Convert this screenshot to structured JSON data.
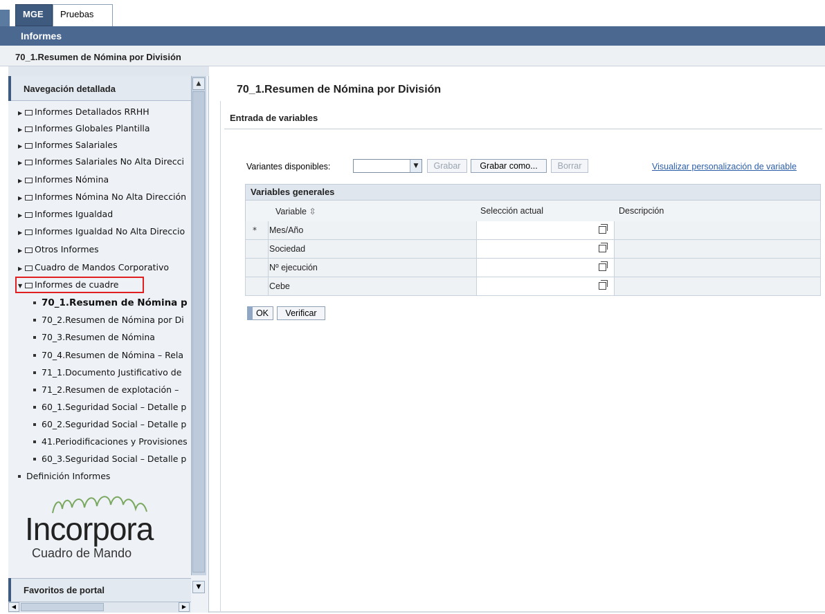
{
  "top_tabs": [
    {
      "label": "MGE"
    },
    {
      "label": "Pruebas"
    }
  ],
  "header": {
    "title": "Informes"
  },
  "breadcrumb": {
    "title": "70_1.Resumen de Nómina por División"
  },
  "nav": {
    "header": "Navegación detallada",
    "folders": [
      {
        "label": "Informes Detallados RRHH"
      },
      {
        "label": "Informes Globales Plantilla"
      },
      {
        "label": "Informes Salariales"
      },
      {
        "label": "Informes Salariales No Alta Direcci"
      },
      {
        "label": "Informes Nómina"
      },
      {
        "label": "Informes Nómina No Alta Dirección"
      },
      {
        "label": "Informes Igualdad"
      },
      {
        "label": "Informes Igualdad No Alta Direccio"
      },
      {
        "label": "Otros Informes"
      },
      {
        "label": "Cuadro de Mandos Corporativo"
      },
      {
        "label": "Informes de cuadre"
      }
    ],
    "sub_items": [
      {
        "label": "70_1.Resumen de Nómina p"
      },
      {
        "label": "70_2.Resumen de Nómina por Di"
      },
      {
        "label": "70_3.Resumen de Nómina"
      },
      {
        "label": "70_4.Resumen de Nómina – Rela"
      },
      {
        "label": "71_1.Documento Justificativo de"
      },
      {
        "label": "71_2.Resumen de explotación –"
      },
      {
        "label": "60_1.Seguridad Social – Detalle p"
      },
      {
        "label": "60_2.Seguridad Social – Detalle p"
      },
      {
        "label": "41.Periodificaciones y Provisiones"
      },
      {
        "label": "60_3.Seguridad Social – Detalle p"
      }
    ],
    "definicion": "Definición Informes",
    "favoritos": "Favoritos de portal"
  },
  "logo": {
    "name": "Incorpora",
    "subtitle": "Cuadro de Mando"
  },
  "content": {
    "title": "70_1.Resumen de Nómina por División",
    "section": "Entrada de variables",
    "variantes_label": "Variantes disponibles:",
    "variantes_value": "",
    "btn_grabar": "Grabar",
    "btn_grabar_como": "Grabar como...",
    "btn_borrar": "Borrar",
    "link_visualizar": "Visualizar personalización de variable",
    "table": {
      "title": "Variables generales",
      "columns": {
        "variable": "Variable",
        "seleccion": "Selección actual",
        "descripcion": "Descripción"
      },
      "rows": [
        {
          "required": "*",
          "variable": "Mes/Año",
          "value": ""
        },
        {
          "required": "",
          "variable": "Sociedad",
          "value": ""
        },
        {
          "required": "",
          "variable": "Nº ejecución",
          "value": ""
        },
        {
          "required": "",
          "variable": "Cebe",
          "value": ""
        }
      ]
    },
    "btn_ok": "OK",
    "btn_verificar": "Verificar"
  },
  "colors": {
    "header": "#4a6890",
    "tab_active": "#3e5b7f",
    "link": "#2a5da8",
    "highlight": "#e02020"
  }
}
